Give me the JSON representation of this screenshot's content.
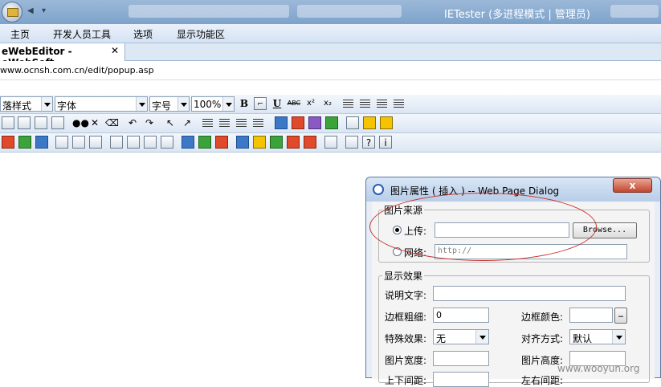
{
  "window": {
    "title": "IETester (多进程模式 | 管理员)"
  },
  "menu": [
    "主页",
    "开发人员工具",
    "选项",
    "显示功能区"
  ],
  "tab": {
    "label": "eWebEditor - eWebSoft...",
    "close": "✕"
  },
  "address": "www.ocnsh.com.cn/edit/popup.asp",
  "toolbar": {
    "para_style": "落样式",
    "font": "字体",
    "size": "字号",
    "zoom": "100%",
    "bold": "B",
    "underline": "U",
    "abc": "ABC",
    "sup": "x²",
    "sub": "x₂"
  },
  "dialog": {
    "title": "图片属性 ( 插入 ) -- Web Page Dialog",
    "close": "x",
    "source_legend": "图片来源",
    "upload_label": "上传:",
    "browse_label": "Browse...",
    "web_label": "网络:",
    "url_placeholder": "http://",
    "effects_legend": "显示效果",
    "alt_label": "说明文字:",
    "border_label": "边框粗细:",
    "border_value": "0",
    "border_color_label": "边框颜色:",
    "special_label": "特殊效果:",
    "special_value": "无",
    "align_label": "对齐方式:",
    "align_value": "默认",
    "width_label": "图片宽度:",
    "height_label": "图片高度:",
    "hspace_label": "上下间距:",
    "vspace_label": "左右间距:"
  },
  "watermark": "www.wooyun.org",
  "colors": {
    "annotation": "#c9302a",
    "title_bar": "#7ea3cb"
  }
}
